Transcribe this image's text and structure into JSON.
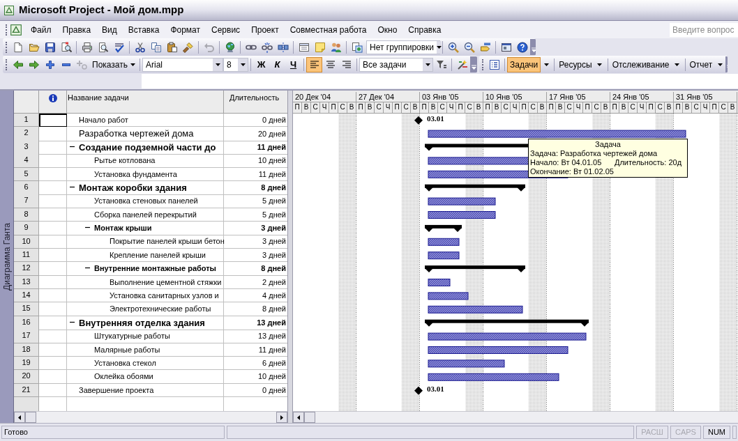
{
  "window": {
    "title": "Microsoft Project - Мой дом.mpp"
  },
  "menu": [
    "Файл",
    "Правка",
    "Вид",
    "Вставка",
    "Формат",
    "Сервис",
    "Проект",
    "Совместная работа",
    "Окно",
    "Справка"
  ],
  "help_search": {
    "placeholder": "Введите вопрос"
  },
  "standard_toolbar": {
    "grouping": "Нет группировки"
  },
  "formatting_toolbar": {
    "show": "Показать",
    "font": "Arial",
    "size": "8",
    "text_styles": [
      {
        "label": "Ж",
        "selected": false
      },
      {
        "label": "К",
        "selected": false
      },
      {
        "label": "Ч",
        "selected": false
      }
    ],
    "align_buttons": [
      {
        "selected": true
      },
      {
        "selected": false
      },
      {
        "selected": false
      }
    ],
    "filter": "Все задачи"
  },
  "views_toolbar": {
    "items": [
      {
        "label": "Задачи",
        "selected": true
      },
      {
        "label": "Ресурсы",
        "selected": false
      },
      {
        "label": "Отслеживание",
        "selected": false
      },
      {
        "label": "Отчет",
        "selected": false
      }
    ]
  },
  "view_bar": {
    "label": "Диаграмма Ганта"
  },
  "table": {
    "columns": [
      "Название задачи",
      "Длительность"
    ],
    "tasks": [
      {
        "num": "1",
        "name": "Начало работ",
        "duration": "0 дней",
        "kind": "milestone",
        "large": false,
        "selected": true,
        "bar_label": "03.01"
      },
      {
        "num": "2",
        "name": "Разработка чертежей дома",
        "duration": "20 дней",
        "kind": "task",
        "large": true,
        "selected": false
      },
      {
        "num": "3",
        "name": "Создание подземной части до",
        "duration": "11 дней",
        "kind": "summary",
        "large": true,
        "selected": false,
        "expanded": true,
        "children": [
          {
            "num": "4",
            "name": "Рытье котлована",
            "duration": "10 дней",
            "kind": "task",
            "large": false,
            "selected": false
          },
          {
            "num": "5",
            "name": "Установка фундамента",
            "duration": "11 дней",
            "kind": "task",
            "large": false,
            "selected": false
          }
        ]
      },
      {
        "num": "6",
        "name": "Монтаж коробки здания",
        "duration": "8 дней",
        "kind": "summary",
        "large": true,
        "selected": false,
        "expanded": true,
        "children": [
          {
            "num": "7",
            "name": "Установка стеновых панелей",
            "duration": "5 дней",
            "kind": "task",
            "large": false,
            "selected": false
          },
          {
            "num": "8",
            "name": "Сборка панелей перекрытий",
            "duration": "5 дней",
            "kind": "task",
            "large": false,
            "selected": false
          },
          {
            "num": "9",
            "name": "Монтаж крыши",
            "duration": "3 дней",
            "kind": "summary",
            "large": false,
            "selected": false,
            "expanded": true,
            "children": [
              {
                "num": "10",
                "name": "Покрытие панелей крыши бетон",
                "duration": "3 дней",
                "kind": "task",
                "large": false,
                "selected": false
              },
              {
                "num": "11",
                "name": "Крепление панелей крыши",
                "duration": "3 дней",
                "kind": "task",
                "large": false,
                "selected": false
              }
            ]
          },
          {
            "num": "12",
            "name": "Внутренние монтажные работы",
            "duration": "8 дней",
            "kind": "summary",
            "large": false,
            "selected": false,
            "expanded": true,
            "children": [
              {
                "num": "13",
                "name": "Выполнение цементной стяжки",
                "duration": "2 дней",
                "kind": "task",
                "large": false,
                "selected": false
              },
              {
                "num": "14",
                "name": "Установка санитарных узлов и",
                "duration": "4 дней",
                "kind": "task",
                "large": false,
                "selected": false
              },
              {
                "num": "15",
                "name": "Электротехнические работы",
                "duration": "8 дней",
                "kind": "task",
                "large": false,
                "selected": false
              }
            ]
          }
        ]
      },
      {
        "num": "16",
        "name": "Внутренняя отделка здания",
        "duration": "13 дней",
        "kind": "summary",
        "large": true,
        "selected": false,
        "expanded": true,
        "children": [
          {
            "num": "17",
            "name": "Штукатурные работы",
            "duration": "13 дней",
            "kind": "task",
            "large": false,
            "selected": false
          },
          {
            "num": "18",
            "name": "Малярные работы",
            "duration": "11 дней",
            "kind": "task",
            "large": false,
            "selected": false
          },
          {
            "num": "19",
            "name": "Установка стекол",
            "duration": "6 дней",
            "kind": "task",
            "large": false,
            "selected": false
          },
          {
            "num": "20",
            "name": "Оклейка обоями",
            "duration": "10 дней",
            "kind": "task",
            "large": false,
            "selected": false
          }
        ]
      },
      {
        "num": "21",
        "name": "Завершение проекта",
        "duration": "0 дней",
        "kind": "milestone",
        "large": false,
        "selected": false,
        "bar_label": "03.01"
      }
    ]
  },
  "timescale": {
    "weeks": [
      {
        "label": "20 Дек '04",
        "days": [
          "П",
          "В",
          "С",
          "Ч",
          "П",
          "С",
          "В"
        ]
      },
      {
        "label": "27 Дек '04",
        "days": [
          "П",
          "В",
          "С",
          "Ч",
          "П",
          "С",
          "В"
        ]
      },
      {
        "label": "03 Янв '05",
        "days": [
          "П",
          "В",
          "С",
          "Ч",
          "П",
          "С",
          "В"
        ]
      },
      {
        "label": "10 Янв '05",
        "days": [
          "П",
          "В",
          "С",
          "Ч",
          "П",
          "С",
          "В"
        ]
      },
      {
        "label": "17 Янв '05",
        "days": [
          "П",
          "В",
          "С",
          "Ч",
          "П",
          "С",
          "В"
        ]
      },
      {
        "label": "24 Янв '05",
        "days": [
          "П",
          "В",
          "С",
          "Ч",
          "П",
          "С",
          "В"
        ]
      },
      {
        "label": "31 Янв '05",
        "days": [
          "П",
          "В",
          "С",
          "Ч",
          "П",
          "С",
          "В"
        ]
      }
    ]
  },
  "tooltip": {
    "title": "Задача",
    "task": "Задача: Разработка чертежей дома",
    "start": "Начало: Вт 04.01.05",
    "duration": "Длительность: 20д",
    "finish": "Окончание: Вт 01.02.05"
  },
  "status_bar": {
    "text": "Готово",
    "indicators": [
      {
        "label": "РАСШ",
        "on": false
      },
      {
        "label": "CAPS",
        "on": false
      },
      {
        "label": "NUM",
        "on": true
      }
    ]
  }
}
